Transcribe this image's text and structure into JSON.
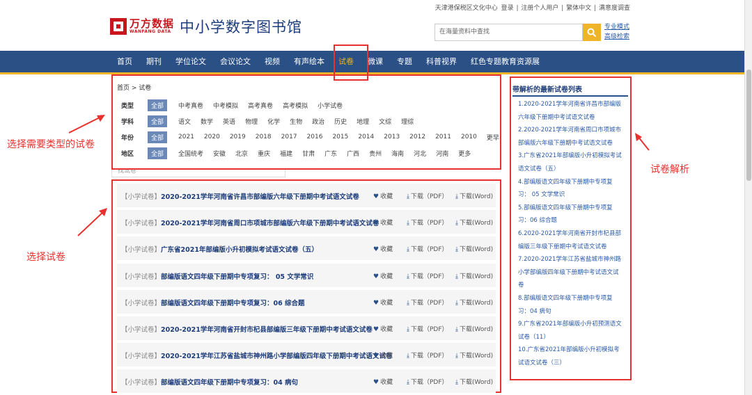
{
  "topbar": {
    "org": "天津港保税区文化中心",
    "login": "登录",
    "register": "注册个人用户",
    "traditional": "繁体中文",
    "survey": "满意度调查"
  },
  "logo": {
    "cn": "万方数据",
    "en": "WANFANG DATA"
  },
  "site_title": "中小学数字图书馆",
  "search": {
    "placeholder": "在海量资料中查找"
  },
  "adv": {
    "pro": "专业模式",
    "advanced": "高级检索"
  },
  "nav": [
    "首页",
    "期刊",
    "学位论文",
    "会议论文",
    "视频",
    "有声绘本",
    "试卷",
    "微课",
    "专题",
    "科普视界",
    "红色专题教育资源展"
  ],
  "nav_active_index": 6,
  "breadcrumb": "首页 > 试卷",
  "filters": {
    "type": {
      "label": "类型",
      "options": [
        "全部",
        "中考真卷",
        "中考模拟",
        "高考真卷",
        "高考模拟",
        "小学试卷"
      ]
    },
    "subject": {
      "label": "学科",
      "options": [
        "全部",
        "语文",
        "数学",
        "英语",
        "物理",
        "化学",
        "生物",
        "政治",
        "历史",
        "地理",
        "文综",
        "理综"
      ]
    },
    "year": {
      "label": "年份",
      "options": [
        "全部",
        "2021",
        "2020",
        "2019",
        "2018",
        "2017",
        "2016",
        "2015",
        "2014",
        "2013",
        "2012",
        "2011",
        "2010",
        "更早"
      ]
    },
    "region": {
      "label": "地区",
      "options": [
        "全部",
        "全国统考",
        "安徽",
        "北京",
        "重庆",
        "福建",
        "甘肃",
        "广东",
        "广西",
        "贵州",
        "海南",
        "河北",
        "河南",
        "更多"
      ]
    }
  },
  "mini_search": "找试卷",
  "list": {
    "tag": "【小学试卷】",
    "collect": "收藏",
    "pdf": "下载（PDF）",
    "word": "下载(Word)",
    "items": [
      "2020-2021学年河南省许昌市部编版六年级下册期中考试语文试卷",
      "2020-2021学年河南省周口市项城市部编版六年级下册期中考试语文试卷",
      "广东省2021年部编版小升初模拟考试语文试卷（五）",
      "部编版语文四年级下册期中专项复习： 05 文学常识",
      "部编版语文四年级下册期中专项复习：06 综合题",
      "2020-2021学年河南省开封市杞县部编版三年级下册期中考试语文试卷",
      "2020-2021学年江苏省盐城市神州路小学部编版四年级下册期中考试语文试卷",
      "部编版语文四年级下册期中专项复习：04 病句"
    ]
  },
  "side": {
    "title": "带解析的最新试卷列表",
    "lines": [
      "1.2020-2021学年河南省许昌市部编版",
      "六年级下册期中考试语文试卷",
      "2.2020-2021学年河南省周口市项城市",
      "部编版六年级下册期中考试语文试卷",
      "3.广东省2021年部编版小升初模拟考试",
      "语文试卷（五）",
      "4.部编版语文四年级下册期中专项复",
      "习： 05 文学常识",
      "5.部编版语文四年级下册期中专项复",
      "习：06 综合题",
      "6.2020-2021学年河南省开封市杞县部",
      "编版三年级下册期中考试语文试卷",
      "7.2020-2021学年江苏省盐城市神州路",
      "小学部编版四年级下册期中考试语文试",
      "卷",
      "8.部编版语文四年级下册期中专项复",
      "习：04 病句",
      "9.广东省2021年部编版小升初预测语文",
      "试卷（11）",
      "10.广东省2021年部编版小升初模拟考",
      "试语文试卷（三）"
    ]
  },
  "annotations": {
    "select_type": "选择需要类型的试卷",
    "select_paper": "选择试卷",
    "analysis": "试卷解析"
  },
  "colors": {
    "nav_bg": "#2b5086",
    "accent": "#f0b429",
    "brand_red": "#c8161d",
    "annotation_red": "#e8312f"
  }
}
